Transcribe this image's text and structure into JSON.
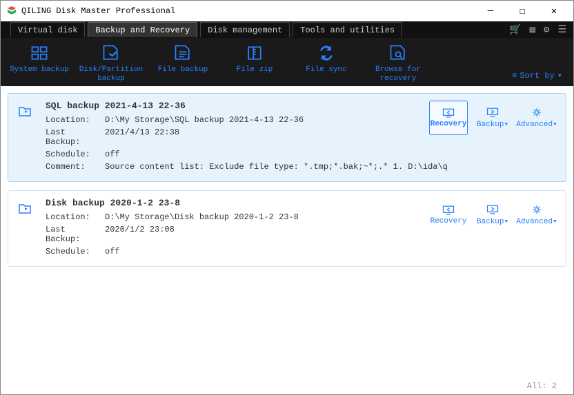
{
  "window": {
    "title": "QILING Disk Master Professional"
  },
  "tabs": {
    "t0": "Virtual disk",
    "t1": "Backup and Recovery",
    "t2": "Disk management",
    "t3": "Tools and utilities"
  },
  "toolbar": {
    "system_backup": "System backup",
    "disk_partition": "Disk/Partition\nbackup",
    "file_backup": "File backup",
    "file_zip": "File zip",
    "file_sync": "File sync",
    "browse": "Browse for\nrecovery",
    "sortby": "Sort by"
  },
  "labels": {
    "location": "Location:",
    "last_backup": "Last Backup:",
    "schedule": "Schedule:",
    "comment": "Comment:",
    "recovery": "Recovery",
    "backup": "Backup▾",
    "advanced": "Advanced▾"
  },
  "tasks": [
    {
      "title": "SQL backup 2021-4-13 22-36",
      "location": "D:\\My Storage\\SQL backup 2021-4-13 22-36",
      "last_backup": "2021/4/13 22:38",
      "schedule": "off",
      "comment": "Source content list:  Exclude file type: *.tmp;*.bak;~*;.*      1. D:\\ida\\q"
    },
    {
      "title": "Disk backup 2020-1-2 23-8",
      "location": "D:\\My Storage\\Disk backup 2020-1-2 23-8",
      "last_backup": "2020/1/2 23:08",
      "schedule": "off"
    }
  ],
  "footer": {
    "all": "All:  2"
  }
}
